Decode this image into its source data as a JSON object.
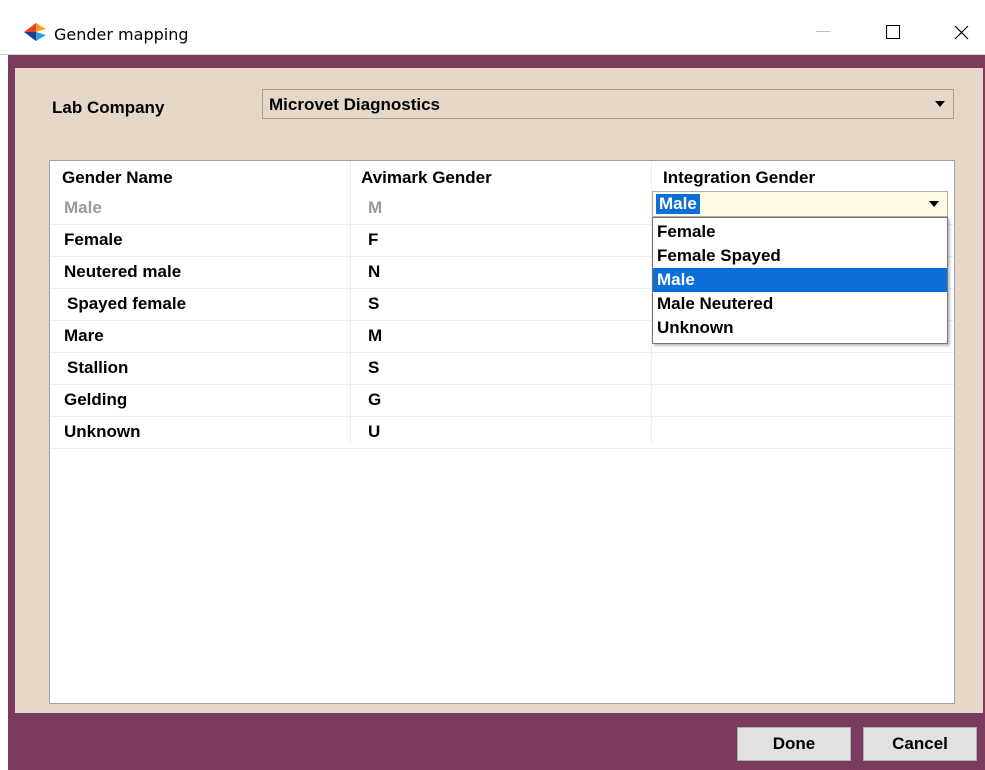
{
  "window": {
    "title": "Gender mapping",
    "minimize_glyph": "—",
    "maximize_glyph": "☐",
    "close_glyph": "✕"
  },
  "lab": {
    "label": "Lab Company",
    "value": "Microvet Diagnostics"
  },
  "grid": {
    "columns": [
      "Gender Name",
      "Avimark Gender",
      "Integration Gender"
    ],
    "rows": [
      {
        "name": "Male",
        "code": "M"
      },
      {
        "name": "Female",
        "code": "F"
      },
      {
        "name": "Neutered male",
        "code": "N"
      },
      {
        "name": "Spayed female",
        "code": "S"
      },
      {
        "name": "Mare",
        "code": "M"
      },
      {
        "name": "Stallion",
        "code": "S"
      },
      {
        "name": "Gelding",
        "code": "G"
      },
      {
        "name": "Unknown",
        "code": "U"
      }
    ],
    "editor": {
      "value": "Male",
      "options": [
        "Female",
        "Female Spayed",
        "Male",
        "Male Neutered",
        "Unknown"
      ],
      "highlighted": "Male"
    }
  },
  "buttons": {
    "done": "Done",
    "cancel": "Cancel"
  },
  "colors": {
    "frame": "#7b3b5e",
    "client": "#e5d8c9",
    "selection": "#0c6fd6",
    "editor_bg": "#fffbe5"
  },
  "icons": {
    "app": "app-logo-icon",
    "dropdown": "chevron-down-icon"
  }
}
